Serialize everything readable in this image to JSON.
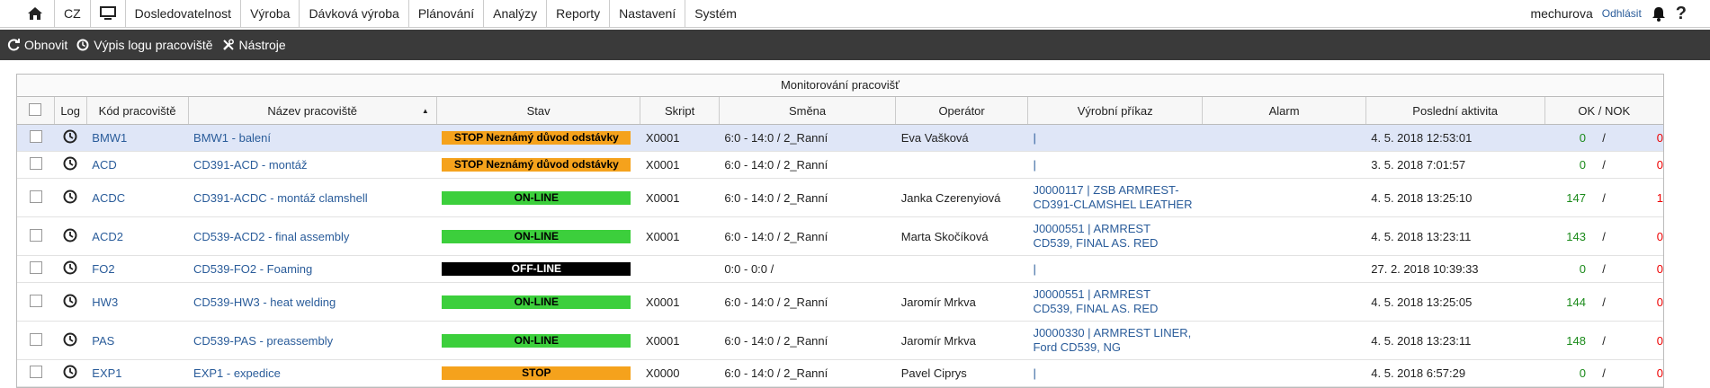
{
  "nav": {
    "lang": "CZ",
    "items": [
      "Dosledovatelnost",
      "Výroba",
      "Dávková výroba",
      "Plánování",
      "Analýzy",
      "Reporty",
      "Nastavení",
      "Systém"
    ],
    "user": "mechurova",
    "logout": "Odhlásit",
    "help": "?"
  },
  "toolbar": {
    "refresh": "Obnovit",
    "log": "Výpis logu pracoviště",
    "tools": "Nástroje"
  },
  "panel": {
    "title": "Monitorování pracovišť"
  },
  "columns": {
    "log": "Log",
    "code": "Kód pracoviště",
    "name": "Název pracoviště",
    "state": "Stav",
    "script": "Skript",
    "shift": "Směna",
    "operator": "Operátor",
    "order": "Výrobní příkaz",
    "alarm": "Alarm",
    "last": "Poslední aktivita",
    "oknok": "OK / NOK"
  },
  "rows": [
    {
      "code": "BMW1",
      "name": "BMW1 - balení",
      "state": "STOP Neznámý důvod odstávky",
      "script": "X0001",
      "shift": "6:0 - 14:0 / 2_Ranní",
      "operator": "Eva Vašková",
      "order1": "|",
      "order2": "",
      "last": "4. 5. 2018 12:53:01",
      "ok": "0",
      "sep": "/",
      "nok": "0"
    },
    {
      "code": "ACD",
      "name": "CD391-ACD - montáž",
      "state": "STOP Neznámý důvod odstávky",
      "script": "X0001",
      "shift": "6:0 - 14:0 / 2_Ranní",
      "operator": "",
      "order1": "|",
      "order2": "",
      "last": "3. 5. 2018 7:01:57",
      "ok": "0",
      "sep": "/",
      "nok": "0"
    },
    {
      "code": "ACDC",
      "name": "CD391-ACDC - montáž clamshell",
      "state": "ON-LINE",
      "script": "X0001",
      "shift": "6:0 - 14:0 / 2_Ranní",
      "operator": "Janka Czerenyiová",
      "order1": "J0000117 | ZSB ARMREST-",
      "order2": "CD391-CLAMSHEL LEATHER",
      "last": "4. 5. 2018 13:25:10",
      "ok": "147",
      "sep": "/",
      "nok": "1"
    },
    {
      "code": "ACD2",
      "name": "CD539-ACD2 - final assembly",
      "state": "ON-LINE",
      "script": "X0001",
      "shift": "6:0 - 14:0 / 2_Ranní",
      "operator": "Marta Skočíková",
      "order1": "J0000551 | ARMREST",
      "order2": "CD539, FINAL AS. RED",
      "last": "4. 5. 2018 13:23:11",
      "ok": "143",
      "sep": "/",
      "nok": "0"
    },
    {
      "code": "FO2",
      "name": "CD539-FO2 - Foaming",
      "state": "OFF-LINE",
      "script": "",
      "shift": "0:0 - 0:0 /",
      "operator": "",
      "order1": "|",
      "order2": "",
      "last": "27. 2. 2018 10:39:33",
      "ok": "0",
      "sep": "/",
      "nok": "0"
    },
    {
      "code": "HW3",
      "name": "CD539-HW3 - heat welding",
      "state": "ON-LINE",
      "script": "X0001",
      "shift": "6:0 - 14:0 / 2_Ranní",
      "operator": "Jaromír Mrkva",
      "order1": "J0000551 | ARMREST",
      "order2": "CD539, FINAL AS. RED",
      "last": "4. 5. 2018 13:25:05",
      "ok": "144",
      "sep": "/",
      "nok": "0"
    },
    {
      "code": "PAS",
      "name": "CD539-PAS - preassembly",
      "state": "ON-LINE",
      "script": "X0001",
      "shift": "6:0 - 14:0 / 2_Ranní",
      "operator": "Jaromír Mrkva",
      "order1": "J0000330 | ARMREST LINER,",
      "order2": "Ford CD539, NG",
      "last": "4. 5. 2018 13:23:11",
      "ok": "148",
      "sep": "/",
      "nok": "0"
    },
    {
      "code": "EXP1",
      "name": "EXP1 - expedice",
      "state": "STOP",
      "script": "X0000",
      "shift": "6:0 - 14:0 / 2_Ranní",
      "operator": "Pavel Ciprys",
      "order1": "|",
      "order2": "",
      "last": "4. 5. 2018 6:57:29",
      "ok": "0",
      "sep": "/",
      "nok": "0"
    }
  ]
}
